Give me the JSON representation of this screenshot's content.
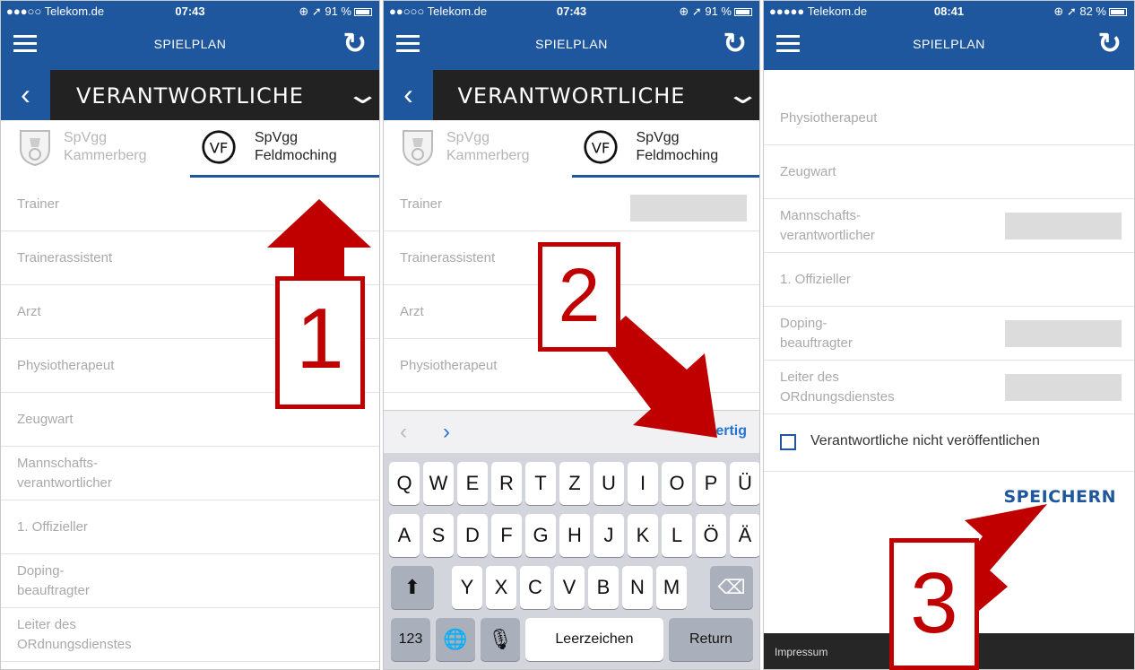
{
  "status": {
    "p1": {
      "carrier": "●●●○○ Telekom.de",
      "time": "07:43",
      "battery": "91 %"
    },
    "p2": {
      "carrier": "●●○○○ Telekom.de",
      "time": "07:43",
      "battery": "91 %"
    },
    "p3": {
      "carrier": "●●●●● Telekom.de",
      "time": "08:41",
      "battery": "82 %"
    }
  },
  "nav": {
    "title": "SPIELPLAN"
  },
  "section": {
    "title": "VERANTWORTLICHE"
  },
  "teams": {
    "home": {
      "line1": "SpVgg",
      "line2": "Kammerberg"
    },
    "away": {
      "line1": "SpVgg",
      "line2": "Feldmoching"
    }
  },
  "form_rows": [
    {
      "label": "Trainer"
    },
    {
      "label": "Trainerassistent"
    },
    {
      "label": "Arzt"
    },
    {
      "label": "Physiotherapeut"
    },
    {
      "label": "Zeugwart"
    },
    {
      "label": "Mannschafts-\nverantwortlicher"
    },
    {
      "label": "1. Offizieller"
    },
    {
      "label": "Doping-\nbeauftragter"
    },
    {
      "label": "Leiter des\nORdnungsdienstes"
    }
  ],
  "keyboard": {
    "done": "Fertig",
    "row1": [
      "Q",
      "W",
      "E",
      "R",
      "T",
      "Z",
      "U",
      "I",
      "O",
      "P",
      "Ü"
    ],
    "row2": [
      "A",
      "S",
      "D",
      "F",
      "G",
      "H",
      "J",
      "K",
      "L",
      "Ö",
      "Ä"
    ],
    "row3": [
      "Y",
      "X",
      "C",
      "V",
      "B",
      "N",
      "M"
    ],
    "numbers": "123",
    "space": "Leerzeichen",
    "return": "Return"
  },
  "screen3": {
    "checkbox_label": "Verantwortliche nicht veröffentlichen",
    "save": "SPEICHERN",
    "footer": "Impressum"
  },
  "steps": [
    "1",
    "2",
    "3"
  ],
  "colors": {
    "brand": "#1f579e",
    "annotation": "#c00000"
  }
}
